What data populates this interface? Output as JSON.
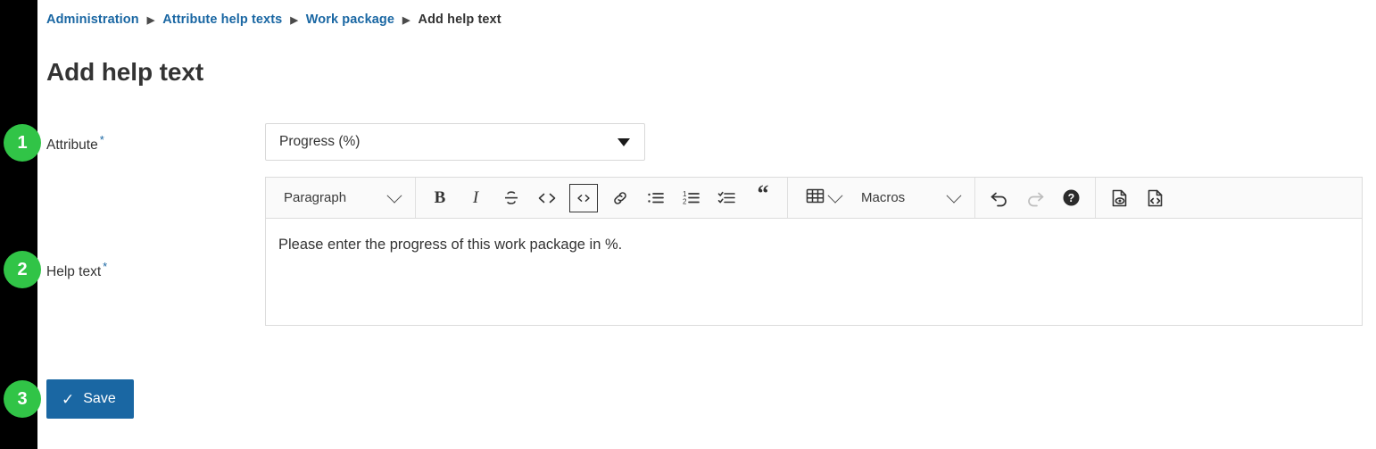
{
  "breadcrumb": {
    "items": [
      {
        "label": "Administration",
        "type": "link"
      },
      {
        "label": "Attribute help texts",
        "type": "link"
      },
      {
        "label": "Work package",
        "type": "link"
      },
      {
        "label": "Add help text",
        "type": "current"
      }
    ],
    "separator": "▶"
  },
  "page": {
    "title": "Add help text"
  },
  "steps": {
    "one": "1",
    "two": "2",
    "three": "3"
  },
  "form": {
    "attribute": {
      "label": "Attribute",
      "required_marker": "*",
      "selected_value": "Progress (%)",
      "caret_icon": "caret-down-icon"
    },
    "help_text": {
      "label": "Help text",
      "required_marker": "*",
      "content": "Please enter the progress of this work package in %."
    }
  },
  "toolbar": {
    "paragraph_dropdown": {
      "label": "Paragraph",
      "chevron_icon": "chevron-down-icon"
    },
    "buttons": [
      {
        "name": "bold-button",
        "glyph": "B"
      },
      {
        "name": "italic-button",
        "glyph": "I"
      },
      {
        "name": "strikethrough-button",
        "glyph": "S"
      },
      {
        "name": "inline-code-button",
        "glyph": "<>"
      },
      {
        "name": "code-block-button",
        "glyph": "<>"
      },
      {
        "name": "link-button",
        "glyph": "link-icon"
      },
      {
        "name": "bulleted-list-button",
        "glyph": "bulleted-list-icon"
      },
      {
        "name": "numbered-list-button",
        "glyph": "numbered-list-icon"
      },
      {
        "name": "todo-list-button",
        "glyph": "todo-list-icon"
      },
      {
        "name": "block-quote-button",
        "glyph": "“"
      }
    ],
    "table_dropdown": {
      "icon": "table-icon",
      "chevron_icon": "chevron-down-icon"
    },
    "macros_dropdown": {
      "label": "Macros",
      "chevron_icon": "chevron-down-icon"
    },
    "history": [
      {
        "name": "undo-button",
        "icon": "undo-arrow-icon",
        "state": "enabled"
      },
      {
        "name": "redo-button",
        "icon": "redo-arrow-icon",
        "state": "disabled"
      },
      {
        "name": "help-button",
        "icon": "question-mark-circle-icon",
        "state": "enabled"
      }
    ],
    "view_modes": [
      {
        "name": "preview-button",
        "icon": "document-eye-icon"
      },
      {
        "name": "source-button",
        "icon": "document-code-icon"
      }
    ]
  },
  "actions": {
    "save": {
      "label": "Save",
      "check_icon": "✓"
    }
  },
  "colors": {
    "badge_green": "#31c447",
    "primary_blue": "#1a67a3",
    "link_blue": "#1A67A3",
    "rail_black": "#000000",
    "text_dark": "#333333"
  }
}
